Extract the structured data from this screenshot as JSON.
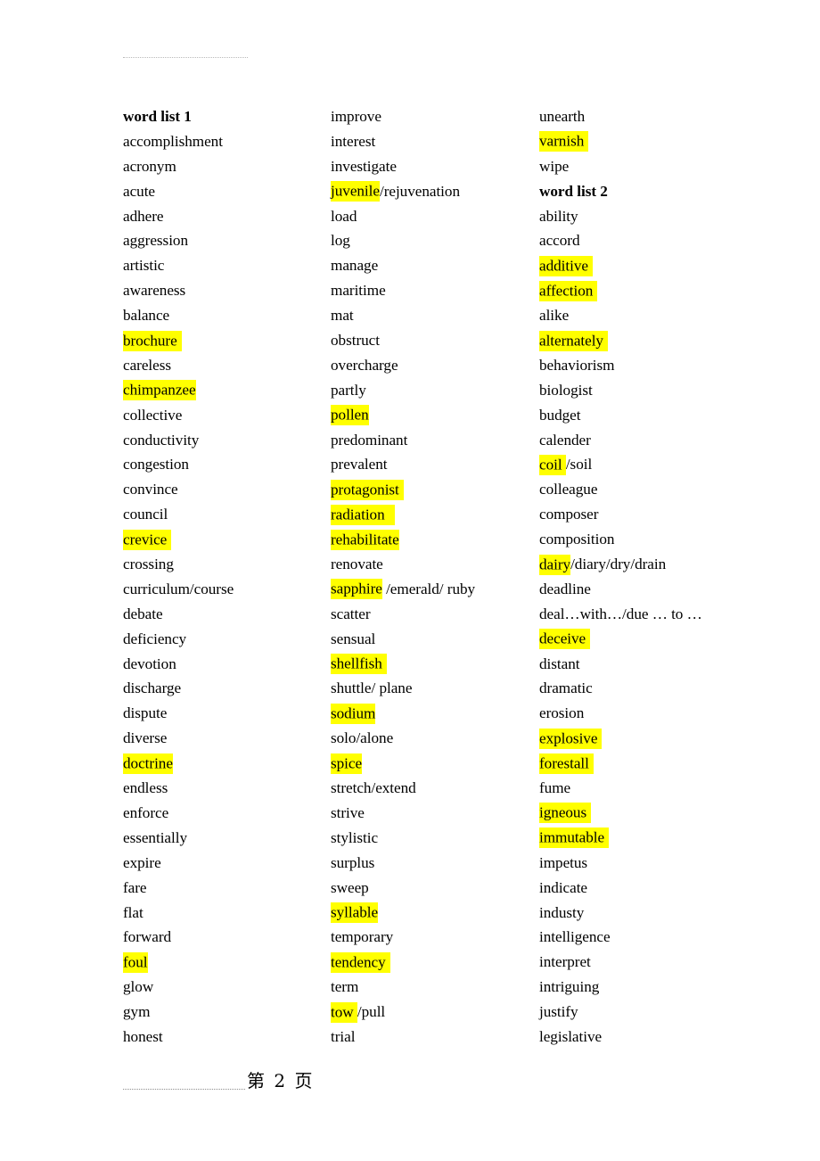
{
  "document": {
    "page_label": "第 2 页",
    "highlight_color": "#ffff00",
    "text_color": "#000000",
    "background_color": "#ffffff"
  },
  "columns": [
    {
      "name": "column-left",
      "entries": [
        {
          "runs": [
            {
              "text": "word list 1",
              "highlight": false
            }
          ],
          "bold": true
        },
        {
          "runs": [
            {
              "text": "accomplishment",
              "highlight": false
            }
          ]
        },
        {
          "runs": [
            {
              "text": "acronym",
              "highlight": false
            }
          ]
        },
        {
          "runs": [
            {
              "text": "acute",
              "highlight": false
            }
          ]
        },
        {
          "runs": [
            {
              "text": "adhere",
              "highlight": false
            }
          ]
        },
        {
          "runs": [
            {
              "text": "aggression",
              "highlight": false
            }
          ]
        },
        {
          "runs": [
            {
              "text": "artistic",
              "highlight": false
            }
          ]
        },
        {
          "runs": [
            {
              "text": "awareness",
              "highlight": false
            }
          ]
        },
        {
          "runs": [
            {
              "text": "balance",
              "highlight": false
            }
          ]
        },
        {
          "runs": [
            {
              "text": "brochure",
              "highlight": true,
              "wide": "sm"
            }
          ]
        },
        {
          "runs": [
            {
              "text": "careless",
              "highlight": false
            }
          ]
        },
        {
          "runs": [
            {
              "text": "chimpanzee",
              "highlight": true
            }
          ]
        },
        {
          "runs": [
            {
              "text": "collective",
              "highlight": false
            }
          ]
        },
        {
          "runs": [
            {
              "text": "conductivity",
              "highlight": false
            }
          ]
        },
        {
          "runs": [
            {
              "text": "congestion",
              "highlight": false
            }
          ]
        },
        {
          "runs": [
            {
              "text": "convince",
              "highlight": false
            }
          ]
        },
        {
          "runs": [
            {
              "text": "council",
              "highlight": false
            }
          ]
        },
        {
          "runs": [
            {
              "text": "crevice",
              "highlight": true,
              "wide": "sm"
            }
          ]
        },
        {
          "runs": [
            {
              "text": "crossing",
              "highlight": false
            }
          ]
        },
        {
          "runs": [
            {
              "text": "curriculum/course",
              "highlight": false
            }
          ]
        },
        {
          "runs": [
            {
              "text": "debate",
              "highlight": false
            }
          ]
        },
        {
          "runs": [
            {
              "text": "deficiency",
              "highlight": false
            }
          ]
        },
        {
          "runs": [
            {
              "text": "devotion",
              "highlight": false
            }
          ]
        },
        {
          "runs": [
            {
              "text": "discharge",
              "highlight": false
            }
          ]
        },
        {
          "runs": [
            {
              "text": "dispute",
              "highlight": false
            }
          ]
        },
        {
          "runs": [
            {
              "text": "diverse",
              "highlight": false
            }
          ]
        },
        {
          "runs": [
            {
              "text": "doctrine",
              "highlight": true
            }
          ]
        },
        {
          "runs": [
            {
              "text": "endless",
              "highlight": false
            }
          ]
        },
        {
          "runs": [
            {
              "text": "enforce",
              "highlight": false
            }
          ]
        },
        {
          "runs": [
            {
              "text": "essentially",
              "highlight": false
            }
          ]
        },
        {
          "runs": [
            {
              "text": "expire",
              "highlight": false
            }
          ]
        },
        {
          "runs": [
            {
              "text": "fare",
              "highlight": false
            }
          ]
        },
        {
          "runs": [
            {
              "text": "flat",
              "highlight": false
            }
          ]
        },
        {
          "runs": [
            {
              "text": "forward",
              "highlight": false
            }
          ]
        },
        {
          "runs": [
            {
              "text": "foul",
              "highlight": true
            }
          ]
        },
        {
          "runs": [
            {
              "text": "glow",
              "highlight": false
            }
          ]
        },
        {
          "runs": [
            {
              "text": "gym",
              "highlight": false
            }
          ]
        },
        {
          "runs": [
            {
              "text": "honest",
              "highlight": false
            }
          ]
        }
      ]
    },
    {
      "name": "column-middle",
      "entries": [
        {
          "runs": [
            {
              "text": "improve",
              "highlight": false
            }
          ]
        },
        {
          "runs": [
            {
              "text": "interest",
              "highlight": false
            }
          ]
        },
        {
          "runs": [
            {
              "text": "investigate",
              "highlight": false
            }
          ]
        },
        {
          "runs": [
            {
              "text": "juvenile",
              "highlight": true
            },
            {
              "text": "/rejuvenation",
              "highlight": false
            }
          ]
        },
        {
          "runs": [
            {
              "text": "load",
              "highlight": false
            }
          ]
        },
        {
          "runs": [
            {
              "text": "log",
              "highlight": false
            }
          ]
        },
        {
          "runs": [
            {
              "text": "manage",
              "highlight": false
            }
          ]
        },
        {
          "runs": [
            {
              "text": "maritime",
              "highlight": false
            }
          ]
        },
        {
          "runs": [
            {
              "text": "mat",
              "highlight": false
            }
          ]
        },
        {
          "runs": [
            {
              "text": "obstruct",
              "highlight": false
            }
          ]
        },
        {
          "runs": [
            {
              "text": "overcharge",
              "highlight": false
            }
          ]
        },
        {
          "runs": [
            {
              "text": "partly",
              "highlight": false
            }
          ]
        },
        {
          "runs": [
            {
              "text": "pollen",
              "highlight": true
            }
          ]
        },
        {
          "runs": [
            {
              "text": "predominant",
              "highlight": false
            }
          ]
        },
        {
          "runs": [
            {
              "text": "prevalent",
              "highlight": false
            }
          ]
        },
        {
          "runs": [
            {
              "text": "protagonist",
              "highlight": true,
              "wide": "sm"
            }
          ]
        },
        {
          "runs": [
            {
              "text": "radiation",
              "highlight": true,
              "wide": "lg"
            }
          ]
        },
        {
          "runs": [
            {
              "text": "rehabilitate",
              "highlight": true
            }
          ]
        },
        {
          "runs": [
            {
              "text": "renovate",
              "highlight": false
            }
          ]
        },
        {
          "runs": [
            {
              "text": "sapphire",
              "highlight": true
            },
            {
              "text": " /emerald/ ruby",
              "highlight": false
            }
          ]
        },
        {
          "runs": [
            {
              "text": "scatter",
              "highlight": false
            }
          ]
        },
        {
          "runs": [
            {
              "text": "sensual",
              "highlight": false
            }
          ]
        },
        {
          "runs": [
            {
              "text": "shellfish",
              "highlight": true,
              "wide": "sm"
            }
          ]
        },
        {
          "runs": [
            {
              "text": "shuttle/ plane",
              "highlight": false
            }
          ]
        },
        {
          "runs": [
            {
              "text": "sodium",
              "highlight": true
            }
          ]
        },
        {
          "runs": [
            {
              "text": "solo/alone",
              "highlight": false
            }
          ]
        },
        {
          "runs": [
            {
              "text": "spice",
              "highlight": true
            }
          ]
        },
        {
          "runs": [
            {
              "text": "stretch/extend",
              "highlight": false
            }
          ]
        },
        {
          "runs": [
            {
              "text": "strive",
              "highlight": false
            }
          ]
        },
        {
          "runs": [
            {
              "text": "stylistic",
              "highlight": false
            }
          ]
        },
        {
          "runs": [
            {
              "text": "surplus",
              "highlight": false
            }
          ]
        },
        {
          "runs": [
            {
              "text": "sweep",
              "highlight": false
            }
          ]
        },
        {
          "runs": [
            {
              "text": "syllable",
              "highlight": true
            }
          ]
        },
        {
          "runs": [
            {
              "text": "temporary",
              "highlight": false
            }
          ]
        },
        {
          "runs": [
            {
              "text": "tendency",
              "highlight": true,
              "wide": "sm"
            }
          ]
        },
        {
          "runs": [
            {
              "text": "term",
              "highlight": false
            }
          ]
        },
        {
          "runs": [
            {
              "text": "tow ",
              "highlight": true
            },
            {
              "text": "/pull",
              "highlight": false
            }
          ]
        },
        {
          "runs": [
            {
              "text": "trial",
              "highlight": false
            }
          ]
        }
      ]
    },
    {
      "name": "column-right",
      "entries": [
        {
          "runs": [
            {
              "text": "unearth",
              "highlight": false
            }
          ]
        },
        {
          "runs": [
            {
              "text": "varnish",
              "highlight": true,
              "wide": "sm"
            }
          ]
        },
        {
          "runs": [
            {
              "text": "wipe",
              "highlight": false
            }
          ]
        },
        {
          "runs": [
            {
              "text": "word list 2",
              "highlight": false
            }
          ],
          "bold": true
        },
        {
          "runs": [
            {
              "text": "ability",
              "highlight": false
            }
          ]
        },
        {
          "runs": [
            {
              "text": "accord",
              "highlight": false
            }
          ]
        },
        {
          "runs": [
            {
              "text": "additive",
              "highlight": true,
              "wide": "sm"
            }
          ]
        },
        {
          "runs": [
            {
              "text": "affection",
              "highlight": true,
              "wide": "sm"
            }
          ]
        },
        {
          "runs": [
            {
              "text": "alike",
              "highlight": false
            }
          ]
        },
        {
          "runs": [
            {
              "text": "alternately",
              "highlight": true,
              "wide": "sm"
            }
          ]
        },
        {
          "runs": [
            {
              "text": "behaviorism",
              "highlight": false
            }
          ]
        },
        {
          "runs": [
            {
              "text": "biologist",
              "highlight": false
            }
          ]
        },
        {
          "runs": [
            {
              "text": "budget",
              "highlight": false
            }
          ]
        },
        {
          "runs": [
            {
              "text": "calender",
              "highlight": false
            }
          ]
        },
        {
          "runs": [
            {
              "text": "coil ",
              "highlight": true
            },
            {
              "text": "/soil",
              "highlight": false
            }
          ]
        },
        {
          "runs": [
            {
              "text": "colleague",
              "highlight": false
            }
          ]
        },
        {
          "runs": [
            {
              "text": "composer",
              "highlight": false
            }
          ]
        },
        {
          "runs": [
            {
              "text": "composition",
              "highlight": false
            }
          ]
        },
        {
          "runs": [
            {
              "text": "dairy",
              "highlight": true
            },
            {
              "text": "/diary/dry/drain",
              "highlight": false
            }
          ]
        },
        {
          "runs": [
            {
              "text": "deadline",
              "highlight": false
            }
          ]
        },
        {
          "runs": [
            {
              "text": "deal…with…/due … to …",
              "highlight": false
            }
          ]
        },
        {
          "runs": [
            {
              "text": "deceive",
              "highlight": true,
              "wide": "sm"
            }
          ]
        },
        {
          "runs": [
            {
              "text": "distant",
              "highlight": false
            }
          ]
        },
        {
          "runs": [
            {
              "text": "dramatic",
              "highlight": false
            }
          ]
        },
        {
          "runs": [
            {
              "text": "erosion",
              "highlight": false
            }
          ]
        },
        {
          "runs": [
            {
              "text": "explosive",
              "highlight": true,
              "wide": "sm"
            }
          ]
        },
        {
          "runs": [
            {
              "text": "forestall",
              "highlight": true,
              "wide": "sm"
            }
          ]
        },
        {
          "runs": [
            {
              "text": "fume",
              "highlight": false
            }
          ]
        },
        {
          "runs": [
            {
              "text": "igneous",
              "highlight": true,
              "wide": "sm"
            }
          ]
        },
        {
          "runs": [
            {
              "text": "immutable",
              "highlight": true,
              "wide": "sm"
            }
          ]
        },
        {
          "runs": [
            {
              "text": "impetus",
              "highlight": false
            }
          ]
        },
        {
          "runs": [
            {
              "text": "indicate",
              "highlight": false
            }
          ]
        },
        {
          "runs": [
            {
              "text": "industy",
              "highlight": false
            }
          ]
        },
        {
          "runs": [
            {
              "text": "intelligence",
              "highlight": false
            }
          ]
        },
        {
          "runs": [
            {
              "text": "interpret",
              "highlight": false
            }
          ]
        },
        {
          "runs": [
            {
              "text": "intriguing",
              "highlight": false
            }
          ]
        },
        {
          "runs": [
            {
              "text": "justify",
              "highlight": false
            }
          ]
        },
        {
          "runs": [
            {
              "text": "legislative",
              "highlight": false
            }
          ]
        }
      ]
    }
  ]
}
